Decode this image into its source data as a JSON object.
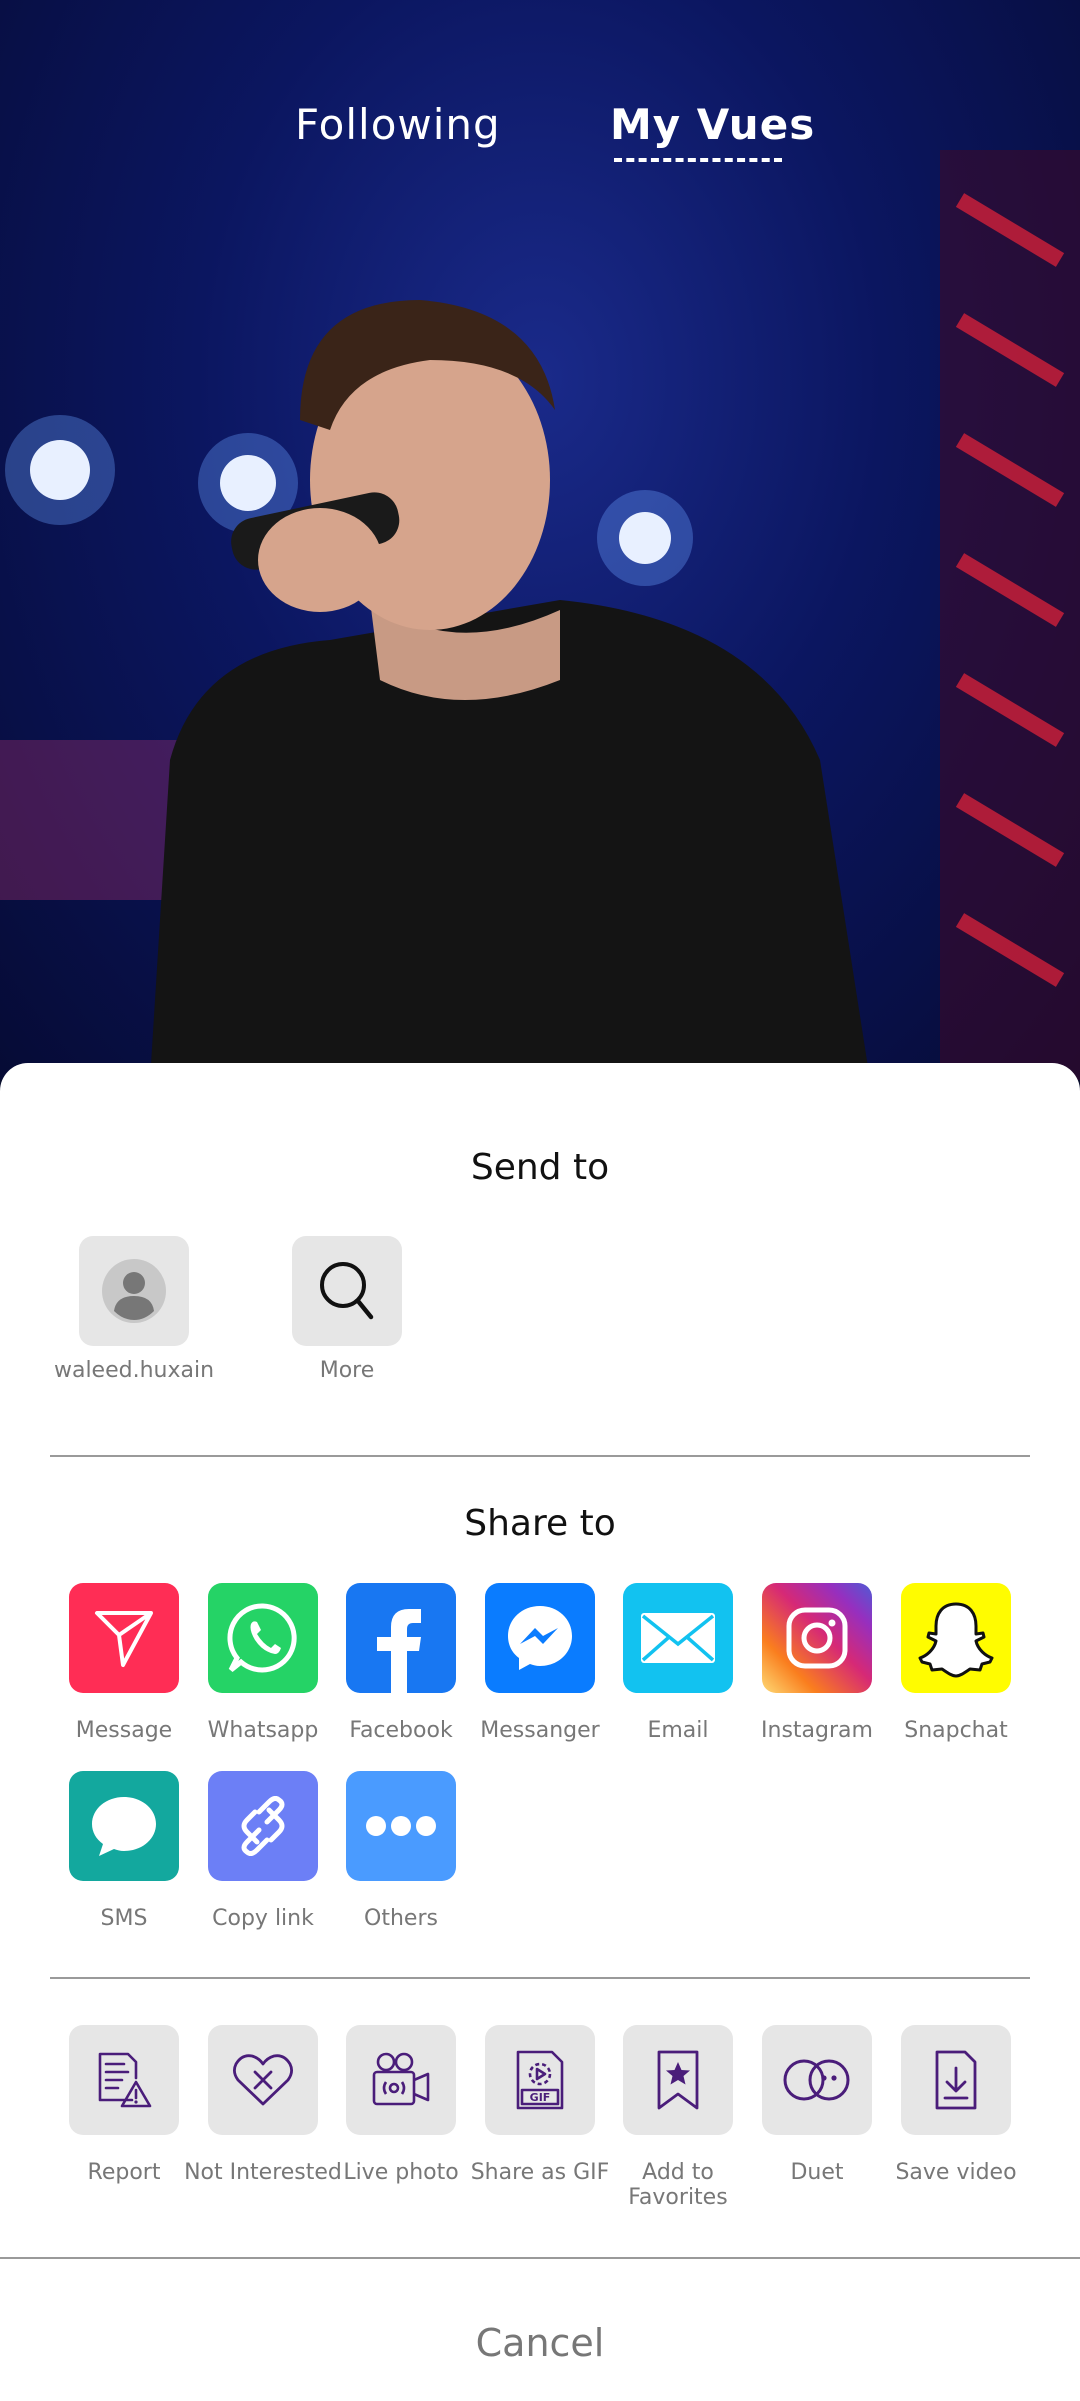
{
  "top_tabs": {
    "following": "Following",
    "my_vues": "My Vues"
  },
  "send_to": {
    "title": "Send to",
    "contacts": [
      {
        "label": "waleed.huxain",
        "icon": "avatar-icon"
      },
      {
        "label": "More",
        "icon": "search-icon"
      }
    ]
  },
  "share_to": {
    "title": "Share to",
    "apps": [
      {
        "label": "Message",
        "icon": "send-icon",
        "color": "#ff2d55"
      },
      {
        "label": "Whatsapp",
        "icon": "whatsapp-icon",
        "color": "#25d366"
      },
      {
        "label": "Facebook",
        "icon": "facebook-icon",
        "color": "#1877f2"
      },
      {
        "label": "Messanger",
        "icon": "messenger-icon",
        "color": "#0a7cff"
      },
      {
        "label": "Email",
        "icon": "email-icon",
        "color": "#12c2f0"
      },
      {
        "label": "Instagram",
        "icon": "instagram-icon",
        "color": "#e1306c"
      },
      {
        "label": "Snapchat",
        "icon": "snapchat-icon",
        "color": "#fffc00"
      },
      {
        "label": "SMS",
        "icon": "chat-bubble-icon",
        "color": "#13a89e"
      },
      {
        "label": "Copy link",
        "icon": "link-icon",
        "color": "#6c7ff6"
      },
      {
        "label": "Others",
        "icon": "more-dots-icon",
        "color": "#4a9bff"
      }
    ]
  },
  "actions": [
    {
      "label": "Report",
      "icon": "report-icon"
    },
    {
      "label": "Not Interested",
      "icon": "heart-x-icon"
    },
    {
      "label": "Live photo",
      "icon": "camera-icon"
    },
    {
      "label": "Share as GIF",
      "icon": "gif-icon"
    },
    {
      "label": "Add to Favorites",
      "icon": "bookmark-star-icon"
    },
    {
      "label": "Duet",
      "icon": "duet-icon"
    },
    {
      "label": "Save video",
      "icon": "download-file-icon"
    }
  ],
  "cancel_label": "Cancel",
  "colors": {
    "icon_purple": "#4a1d7a",
    "label_gray": "#777777",
    "tile_gray": "#e6e6e6"
  }
}
